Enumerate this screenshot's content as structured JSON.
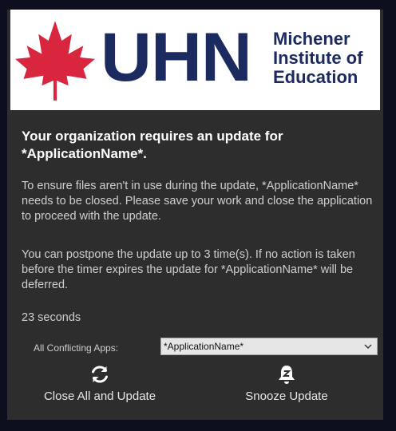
{
  "banner": {
    "logo_text": "UHN",
    "institute_lines": [
      "Michener",
      "Institute of",
      "Education"
    ],
    "colors": {
      "leaf": "#d8263f",
      "brand_navy": "#1c2b5f"
    }
  },
  "dialog": {
    "title": "Your organization requires an update for *ApplicationName*.",
    "message": "To ensure files aren't in use during the update, *ApplicationName* needs to be closed. Please save your work and close the application to proceed with the update.",
    "postpone_message": "You can postpone the update up to 3 time(s). If no action is taken before the timer expires the update for *ApplicationName* will be deferred.",
    "countdown": "23 seconds",
    "conflicting_apps_label": "All Conflicting Apps:",
    "conflicting_apps_selected": "*ApplicationName*"
  },
  "actions": {
    "close_all": {
      "label": "Close All and Update",
      "icon": "refresh-icon"
    },
    "snooze": {
      "label": "Snooze Update",
      "icon": "snooze-bell-icon"
    }
  },
  "colors": {
    "page_bg": "#0d0f1e",
    "dialog_bg": "#2d2d2d",
    "text": "#cfcfcf",
    "title": "#ffffff"
  }
}
